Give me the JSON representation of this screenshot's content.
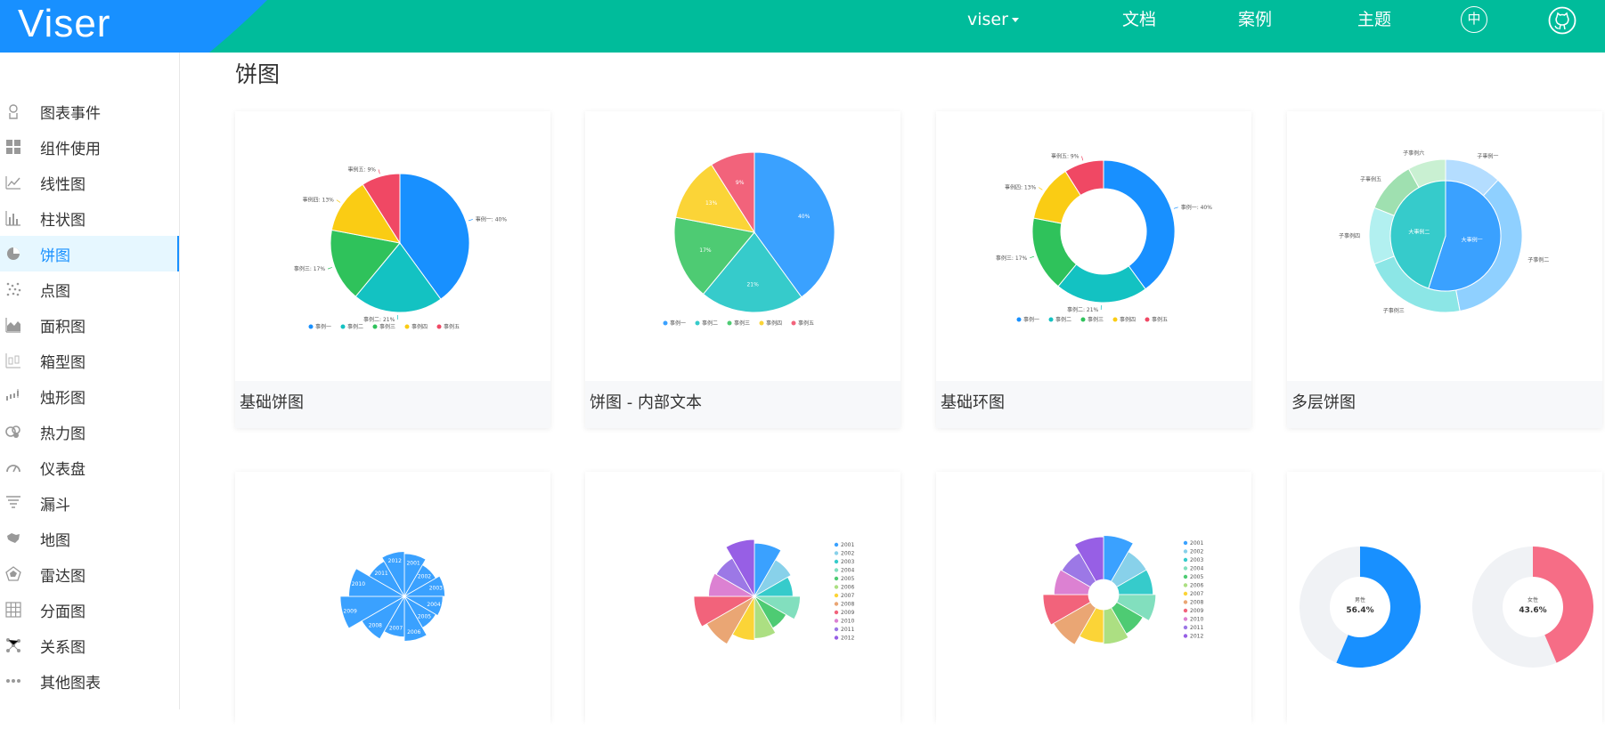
{
  "app": {
    "logo": "Viser"
  },
  "nav": {
    "viser": "viser",
    "docs": "文档",
    "examples": "案例",
    "theme": "主题",
    "lang": "中"
  },
  "sidebar": {
    "items": [
      {
        "label": "图表事件",
        "icon": "event-icon"
      },
      {
        "label": "组件使用",
        "icon": "component-icon"
      },
      {
        "label": "线性图",
        "icon": "line-chart-icon"
      },
      {
        "label": "柱状图",
        "icon": "bar-chart-icon"
      },
      {
        "label": "饼图",
        "icon": "pie-chart-icon",
        "active": true
      },
      {
        "label": "点图",
        "icon": "scatter-icon"
      },
      {
        "label": "面积图",
        "icon": "area-chart-icon"
      },
      {
        "label": "箱型图",
        "icon": "box-plot-icon"
      },
      {
        "label": "烛形图",
        "icon": "candle-icon"
      },
      {
        "label": "热力图",
        "icon": "heatmap-icon"
      },
      {
        "label": "仪表盘",
        "icon": "gauge-icon"
      },
      {
        "label": "漏斗",
        "icon": "funnel-icon"
      },
      {
        "label": "地图",
        "icon": "map-icon"
      },
      {
        "label": "雷达图",
        "icon": "radar-icon"
      },
      {
        "label": "分面图",
        "icon": "facet-icon"
      },
      {
        "label": "关系图",
        "icon": "relation-icon"
      },
      {
        "label": "其他图表",
        "icon": "more-icon"
      }
    ]
  },
  "page": {
    "title": "饼图"
  },
  "cards": [
    {
      "caption": "基础饼图"
    },
    {
      "caption": "饼图 - 内部文本"
    },
    {
      "caption": "基础环图"
    },
    {
      "caption": "多层饼图"
    },
    {
      "caption": ""
    },
    {
      "caption": ""
    },
    {
      "caption": ""
    },
    {
      "caption": ""
    }
  ],
  "thumbs": {
    "basic_pie": {
      "slices": [
        {
          "label": "事例一",
          "value": 40,
          "text": "事例一: 40%",
          "color": "#1890ff"
        },
        {
          "label": "事例二",
          "value": 21,
          "text": "事例二: 21%",
          "color": "#13c2c2"
        },
        {
          "label": "事例三",
          "value": 17,
          "text": "事例三: 17%",
          "color": "#2fc25b"
        },
        {
          "label": "事例四",
          "value": 13,
          "text": "事例四: 13%",
          "color": "#facc14"
        },
        {
          "label": "事例五",
          "value": 9,
          "text": "事例五: 9%",
          "color": "#f04864"
        }
      ]
    },
    "inner_pie": {
      "slices": [
        {
          "label": "事例一",
          "value": 40,
          "text": "40%",
          "color": "#3aa1ff"
        },
        {
          "label": "事例二",
          "value": 21,
          "text": "21%",
          "color": "#36cbcb"
        },
        {
          "label": "事例三",
          "value": 17,
          "text": "17%",
          "color": "#4ecb73"
        },
        {
          "label": "事例四",
          "value": 13,
          "text": "13%",
          "color": "#fbd437"
        },
        {
          "label": "事例五",
          "value": 9,
          "text": "9%",
          "color": "#f2637b"
        }
      ]
    },
    "donut": {
      "slices": [
        {
          "label": "事例一",
          "value": 40,
          "text": "事例一: 40%",
          "color": "#1890ff"
        },
        {
          "label": "事例二",
          "value": 21,
          "text": "事例二: 21%",
          "color": "#13c2c2"
        },
        {
          "label": "事例三",
          "value": 17,
          "text": "事例三: 17%",
          "color": "#2fc25b"
        },
        {
          "label": "事例四",
          "value": 13,
          "text": "事例四: 13%",
          "color": "#facc14"
        },
        {
          "label": "事例五",
          "value": 9,
          "text": "事例五: 9%",
          "color": "#f04864"
        }
      ]
    },
    "multi_layer": {
      "inner": [
        {
          "label": "大事例一",
          "value": 55,
          "color": "#3aa1ff"
        },
        {
          "label": "大事例二",
          "value": 45,
          "color": "#36cbcb"
        }
      ],
      "outer": [
        {
          "label": "子事例一",
          "value": 12,
          "color": "#b4ddff"
        },
        {
          "label": "子事例二",
          "value": 35,
          "color": "#8fd0ff"
        },
        {
          "label": "子事例三",
          "value": 22,
          "color": "#8ce6e6"
        },
        {
          "label": "子事例四",
          "value": 12,
          "color": "#b2f0f0"
        },
        {
          "label": "子事例五",
          "value": 11,
          "color": "#9fe0b0"
        },
        {
          "label": "子事例六",
          "value": 8,
          "color": "#c9f0d2"
        }
      ]
    },
    "rose_single": {
      "labels": [
        "2001",
        "2002",
        "2003",
        "2004",
        "2005",
        "2006",
        "2007",
        "2008",
        "2009",
        "2010",
        "2011",
        "2012"
      ],
      "values": [
        40,
        34,
        38,
        36,
        34,
        42,
        38,
        46,
        60,
        52,
        38,
        42
      ],
      "color": "#3aa1ff"
    },
    "rose_multi": {
      "labels": [
        "2001",
        "2002",
        "2003",
        "2004",
        "2005",
        "2006",
        "2007",
        "2008",
        "2009",
        "2010",
        "2011",
        "2012"
      ],
      "values": [
        58,
        46,
        42,
        50,
        40,
        46,
        48,
        60,
        66,
        50,
        48,
        62
      ],
      "colors": [
        "#3aa1ff",
        "#88d1ea",
        "#36cbcb",
        "#82dfbe",
        "#4ecb73",
        "#acdf82",
        "#fbd437",
        "#eaa674",
        "#f2637b",
        "#dc81d2",
        "#9c78e6",
        "#975fe5"
      ]
    },
    "rose_donut": {
      "labels": [
        "2001",
        "2002",
        "2003",
        "2004",
        "2005",
        "2006",
        "2007",
        "2008",
        "2009",
        "2010",
        "2011",
        "2012"
      ],
      "values": [
        64,
        50,
        50,
        54,
        44,
        50,
        48,
        62,
        66,
        50,
        48,
        62
      ],
      "colors": [
        "#3aa1ff",
        "#88d1ea",
        "#36cbcb",
        "#82dfbe",
        "#4ecb73",
        "#acdf82",
        "#fbd437",
        "#eaa674",
        "#f2637b",
        "#dc81d2",
        "#9c78e6",
        "#975fe5"
      ]
    },
    "gauge_donuts": [
      {
        "label": "男性",
        "percent": 56.4,
        "text": "56.4%",
        "color": "#1890ff",
        "bg": "#f0f2f5"
      },
      {
        "label": "女性",
        "percent": 43.6,
        "text": "43.6%",
        "color": "#f66d86",
        "bg": "#f0f2f5"
      }
    ]
  }
}
